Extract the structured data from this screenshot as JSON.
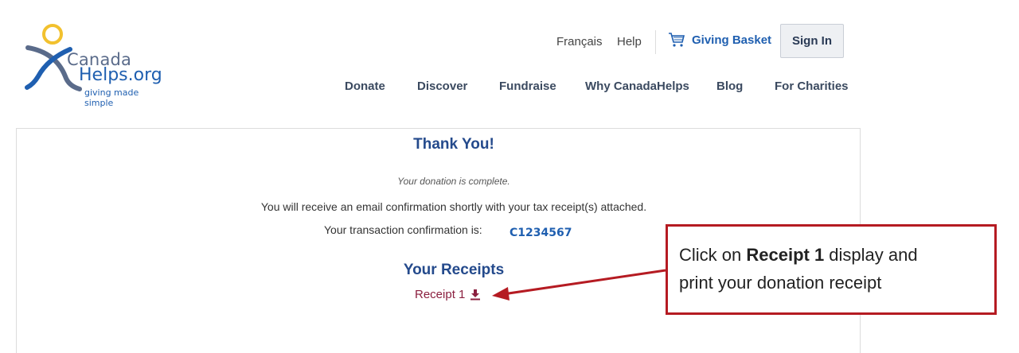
{
  "logo": {
    "line1": "Canada",
    "line2": "Helps.org",
    "tagline": "giving made simple"
  },
  "header": {
    "francais": "Français",
    "help": "Help",
    "basket": "Giving Basket",
    "signin": "Sign In",
    "nav": [
      "Donate",
      "Discover",
      "Fundraise",
      "Why CanadaHelps",
      "Blog",
      "For Charities"
    ]
  },
  "confirmation": {
    "title": "Thank You!",
    "complete": "Your donation is complete.",
    "email_message": "You will receive an email confirmation shortly with your tax receipt(s) attached.",
    "conf_label": "Your transaction confirmation is:",
    "conf_number": "C1234567",
    "receipts_title": "Your Receipts",
    "receipt_link": "Receipt 1"
  },
  "annotation": {
    "text_prefix": "Click on ",
    "text_bold": "Receipt 1",
    "text_suffix_line1": " display and",
    "text_line2": "print your donation receipt"
  },
  "colors": {
    "brand_blue": "#1f5fb0",
    "title_blue": "#244a8c",
    "receipt_link": "#8b1f3f",
    "callout_red": "#b51b22",
    "logo_yellow": "#f2c12e"
  },
  "icons": [
    "cart-icon",
    "download-icon"
  ]
}
